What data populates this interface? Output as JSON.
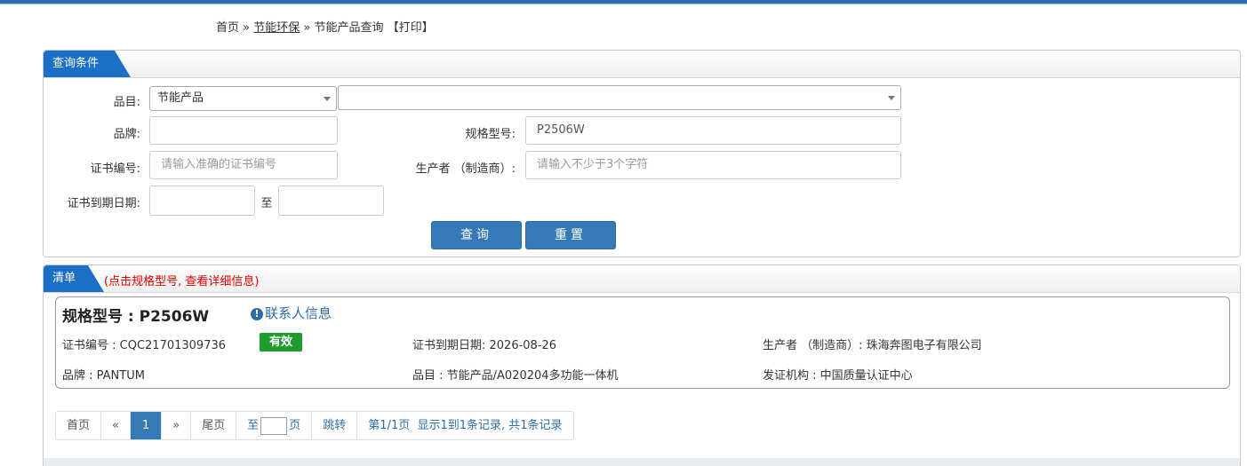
{
  "breadcrumb": {
    "home": "首页",
    "sep1": "»",
    "category": "节能环保",
    "sep2": "»",
    "current": "节能产品查询",
    "print": "【打印】"
  },
  "query_panel": {
    "title": "查询条件",
    "category_label": "品目:",
    "category_value": "节能产品",
    "subcategory_value": "",
    "brand_label": "品牌:",
    "brand_value": "",
    "model_label": "规格型号:",
    "model_value": "P2506W",
    "cert_no_label": "证书编号:",
    "cert_no_placeholder": "请输入准确的证书编号",
    "manufacturer_label": "生产者 （制造商）:",
    "manufacturer_placeholder": "请输入不少于3个字符",
    "expiry_label": "证书到期日期:",
    "expiry_to": "至",
    "search_button": "查询",
    "reset_button": "重置"
  },
  "list_panel": {
    "title": "清单",
    "note": "(点击规格型号, 查看详细信息)",
    "record": {
      "model_heading": "规格型号 : P2506W",
      "contact_link": "联系人信息",
      "cert_no": "证书编号 : CQC21701309736",
      "status": "有效",
      "expiry": "证书到期日期: 2026-08-26",
      "manufacturer": "生产者 （制造商）: 珠海奔图电子有限公司",
      "brand": "品牌 : PANTUM",
      "category": "品目 : 节能产品/A020204多功能一体机",
      "issuer": "发证机构 : 中国质量认证中心"
    }
  },
  "pagination": {
    "first": "首页",
    "prev": "«",
    "current": "1",
    "next": "»",
    "last": "尾页",
    "goto_prefix": "至",
    "goto_suffix": "页",
    "jump": "跳转",
    "summary": "第1/1页  显示1到1条记录, 共1条记录"
  }
}
